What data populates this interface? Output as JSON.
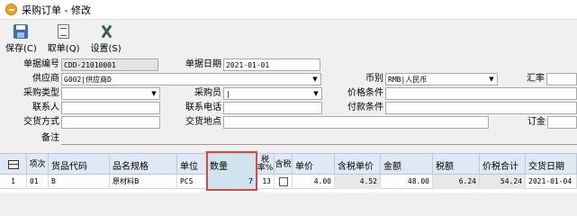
{
  "window": {
    "title": "采购订单 - 修改"
  },
  "toolbar": {
    "save": "保存(C)",
    "cancel": "取单(Q)",
    "settings": "设置(S)"
  },
  "form": {
    "order_no_label": "单据编号",
    "order_no": "CDD-21010001",
    "order_date_label": "单据日期",
    "order_date": "2021-01-01",
    "supplier_label": "供应商",
    "supplier": "G002|供应商D",
    "currency_label": "币别",
    "currency": "RMB|人民币",
    "rate_label": "汇率",
    "rate": "",
    "purchase_type_label": "采购类型",
    "purchase_type": "",
    "buyer_label": "采购员",
    "buyer": "|",
    "price_terms_label": "价格条件",
    "price_terms": "",
    "contact_label": "联系人",
    "contact": "",
    "phone_label": "联系电话",
    "phone": "",
    "payment_terms_label": "付款条件",
    "payment_terms": "",
    "delivery_method_label": "交货方式",
    "delivery_method": "",
    "delivery_place_label": "交货地点",
    "delivery_place": "",
    "deposit_label": "订金",
    "deposit": "",
    "remark_label": "备注",
    "remark": ""
  },
  "grid": {
    "headers": {
      "seq": "项次",
      "code": "货品代码",
      "spec": "品名规格",
      "unit": "单位",
      "qty": "数量",
      "tax_rate": "税率%",
      "tax_incl": "含税",
      "price": "单价",
      "tax_price": "含税单价",
      "amount": "金额",
      "tax": "税额",
      "total": "价税合计",
      "delivery_date": "交货日期"
    },
    "rows": [
      {
        "row_no": "1",
        "seq": "01",
        "code": "B",
        "spec": "原材料B",
        "unit": "PCS",
        "qty": "7",
        "tax_rate": "13",
        "tax_incl": false,
        "price": "4.00",
        "tax_price": "4.52",
        "amount": "48.00",
        "tax": "6.24",
        "total": "54.24",
        "delivery_date": "2021-01-04"
      }
    ]
  }
}
